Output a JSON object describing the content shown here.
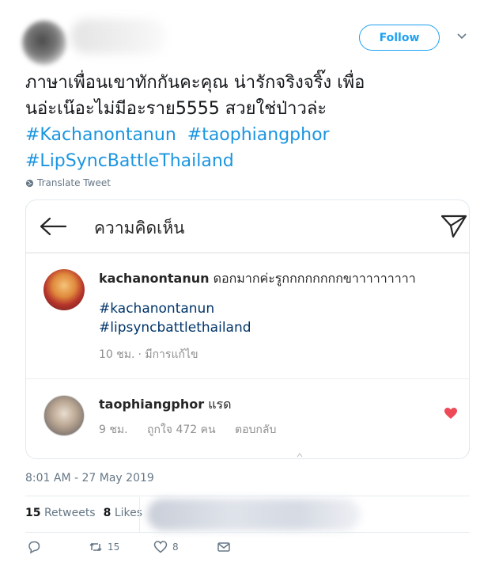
{
  "header": {
    "follow_label": "Follow"
  },
  "tweet": {
    "lines": [
      "ภาษาเพื่อนเขาทักกันคะคุณ น่ารักจริงจริ๊ง เพื่อ",
      "นอ่ะเน๊อะไม่มีอะราย5555 สวยใช่ป่าวล่ะ"
    ],
    "hashtags": [
      "#Kachanontanun",
      "#taophiangphor",
      "#LipSyncBattleThailand"
    ],
    "translate_label": "Translate Tweet"
  },
  "embedded": {
    "title": "ความคิดเห็น",
    "comments": [
      {
        "user": "kachanontanun",
        "text": "ดอกมากค่ะรูกกกกกกกกขาาาาาาาาา",
        "tags": [
          "#kachanontanun",
          "#lipsyncbattlethailand"
        ],
        "time": "10 ชม.",
        "edited": "· มีการแก้ไข"
      },
      {
        "user": "taophiangphor",
        "text": "แรด",
        "time": "9 ชม.",
        "likes": "ถูกใจ 472 คน",
        "reply": "ตอบกลับ"
      }
    ]
  },
  "timestamp": "8:01 AM - 27 May 2019",
  "stats": {
    "retweets_count": "15",
    "retweets_label": "Retweets",
    "likes_count": "8",
    "likes_label": "Likes"
  },
  "actions": {
    "retweet_count": "15",
    "like_count": "8"
  },
  "colors": {
    "accent": "#1da1f2",
    "hashtag": "#1b95e0",
    "heart": "#ed4956"
  }
}
